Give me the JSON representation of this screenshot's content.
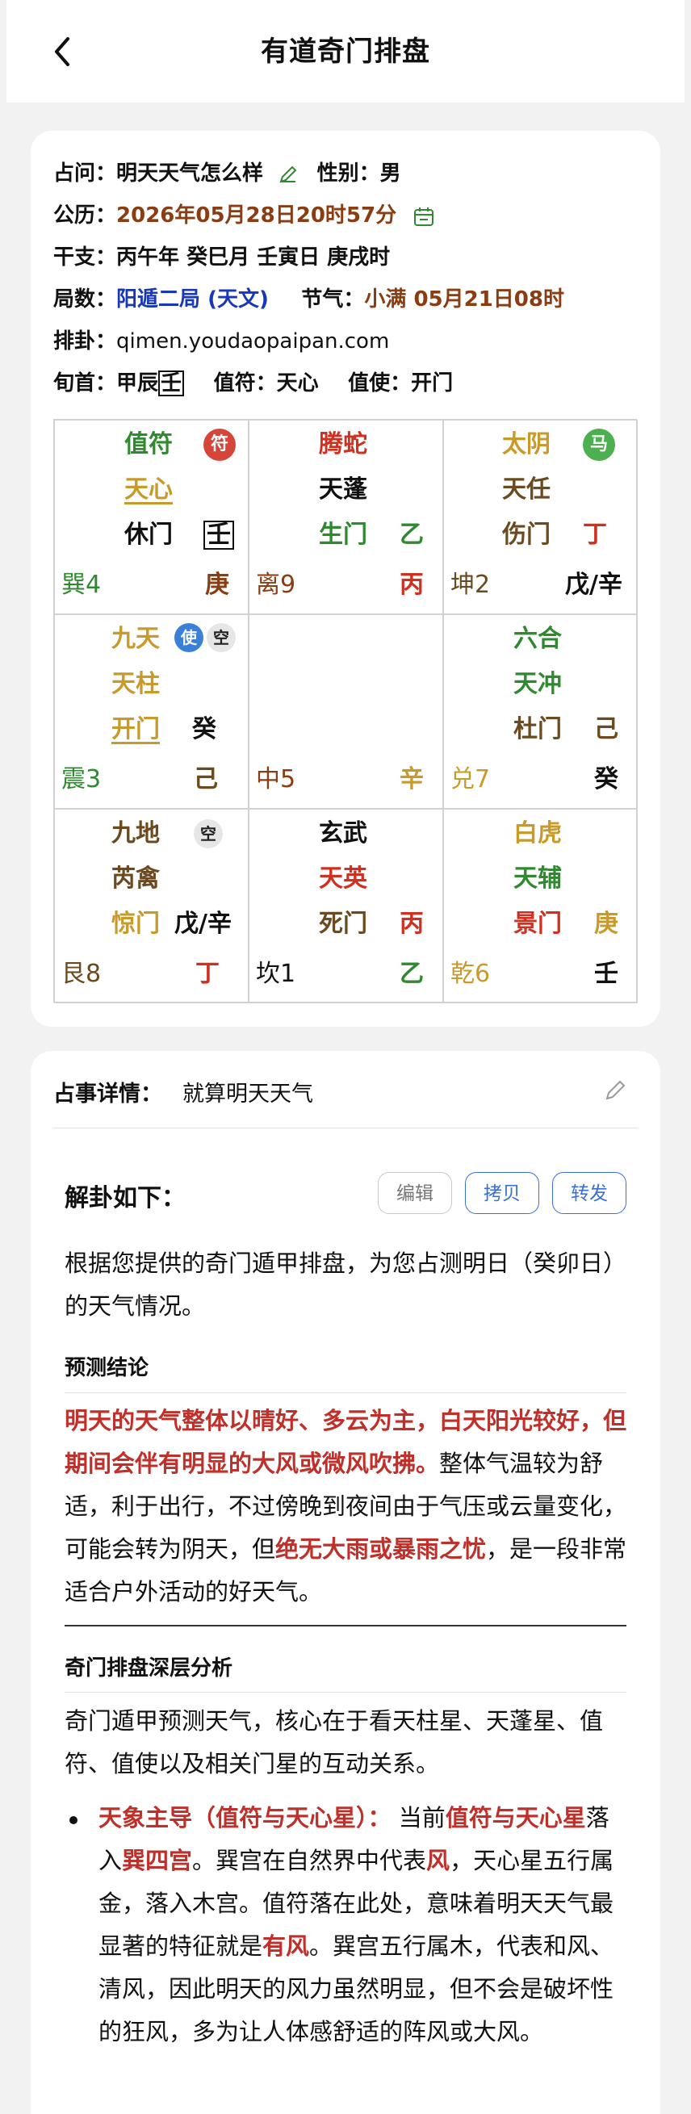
{
  "header": {
    "title": "有道奇门排盘"
  },
  "info": {
    "question_label": "占问：",
    "question": "明天天气怎么样",
    "gender_label": "性别：",
    "gender": "男",
    "solar_label": "公历：",
    "solar": "2026年05月28日20时57分",
    "ganzhi_label": "干支：",
    "ganzhi": "丙午年 癸巳月 壬寅日 庚戌时",
    "ju_label": "局数：",
    "ju": "阳遁二局 (天文)",
    "jieqi_label": "节气：",
    "jieqi": "小满 05月21日08时",
    "paipan_label": "排卦：",
    "paipan": "qimen.youdaopaipan.com",
    "xunshou_label": "旬首：",
    "xunshou": "甲辰",
    "xunshou_box": "壬",
    "zhifu_label": "值符：",
    "zhifu": "天心",
    "zhishi_label": "值使：",
    "zhishi": "开门"
  },
  "grid": {
    "xun": {
      "god": "值符",
      "star": "天心",
      "door": "休门",
      "stem_box": "壬",
      "palace": "巽4",
      "stem": "庚",
      "badge": "符"
    },
    "li": {
      "god": "腾蛇",
      "star": "天蓬",
      "door": "生门",
      "door_stem": "乙",
      "palace": "离9",
      "stem": "丙"
    },
    "kun": {
      "god": "太阴",
      "star": "天任",
      "door": "伤门",
      "door_stem": "丁",
      "palace": "坤2",
      "stem": "戊/辛",
      "badge": "马"
    },
    "zhen": {
      "god": "九天",
      "star": "天柱",
      "door": "开门",
      "door_stem": "癸",
      "palace": "震3",
      "stem": "己",
      "badge": "使",
      "kong": "空"
    },
    "zhong": {
      "palace": "中5",
      "stem": "辛"
    },
    "dui": {
      "god": "六合",
      "star": "天冲",
      "door": "杜门",
      "door_stem": "己",
      "palace": "兑7",
      "stem": "癸"
    },
    "gen": {
      "god": "九地",
      "star": "芮禽",
      "door": "惊门",
      "door_stem": "戊/辛",
      "palace": "艮8",
      "stem": "丁",
      "kong": "空"
    },
    "kan": {
      "god": "玄武",
      "star": "天英",
      "door": "死门",
      "door_stem": "丙",
      "palace": "坎1",
      "stem": "乙"
    },
    "qian": {
      "god": "白虎",
      "star": "天辅",
      "door": "景门",
      "door_stem": "庚",
      "palace": "乾6",
      "stem": "壬"
    }
  },
  "detail": {
    "label": "占事详情：",
    "value": "就算明天天气",
    "jiegua": "解卦如下：",
    "edit": "编辑",
    "copy": "拷贝",
    "forward": "转发",
    "intro": "根据您提供的奇门遁甲排盘，为您占测明日（癸卯日）的天气情况。",
    "conclusion_title": "预测结论",
    "conclusion_hl1": "明天的天气整体以晴好、多云为主，白天阳光较好，但期间会伴有明显的大风或微风吹拂。",
    "conclusion_t1": "整体气温较为舒适，利于出行，不过傍晚到夜间由于气压或云量变化，可能会转为阴天，但",
    "conclusion_hl2": "绝无大雨或暴雨之忧",
    "conclusion_t2": "，是一段非常适合户外活动的好天气。",
    "analysis_title": "奇门排盘深层分析",
    "analysis_intro": "奇门遁甲预测天气，核心在于看天柱星、天蓬星、值符、值使以及相关门星的互动关系。",
    "bullet_hl1": "天象主导（值符与天心星）：",
    "bullet_t1": " 当前",
    "bullet_hl2": "值符与天心星",
    "bullet_t2": "落入",
    "bullet_hl3": "巽四宫",
    "bullet_t3": "。巽宫在自然界中代表",
    "bullet_hl4": "风",
    "bullet_t4": "，天心星五行属金，落入木宫。值符落在此处，意味着明天天气最显著的特征就是",
    "bullet_hl5": "有风",
    "bullet_t5": "。巽宫五行属木，代表和风、清风，因此明天的风力虽然明显，但不会是破坏性的狂风，多为让人体感舒适的阵风或大风。"
  },
  "colors": {
    "accent_blue": "#3a6fd8",
    "highlight_red": "#c0302a"
  }
}
